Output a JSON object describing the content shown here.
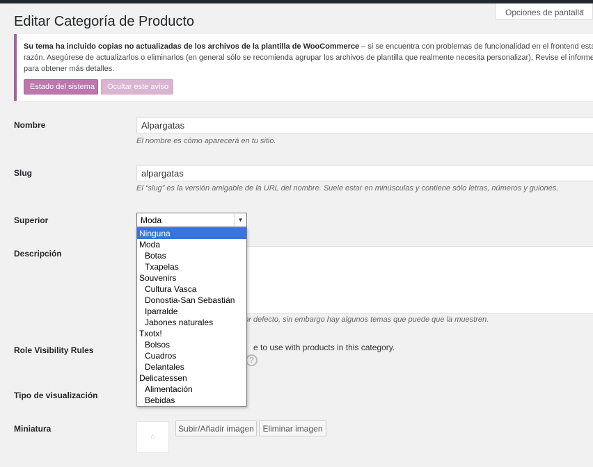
{
  "screen_options": {
    "label": "Opciones de pantalla",
    "arrow": "▼"
  },
  "page": {
    "title": "Editar Categoría de Producto"
  },
  "notice": {
    "bold": "Su tema ha incluido copias no actualizadas de los archivos de la plantilla de WooCommerce",
    "line1_rest": " – si se encuentra con problemas de funcionalidad en el frontend esta podr",
    "line2": "razón. Asegúrese de actualizarlos o eliminarlos (en general sólo se recomienda agrupar los archivos de plantilla que realmente necesita personalizar). Revise el informe d",
    "line3": "para obtener más detalles.",
    "status_button": "Estado del sistema",
    "hide_button": "Ocultar este aviso"
  },
  "form": {
    "name_label": "Nombre",
    "name_value": "Alpargatas",
    "name_desc": "El nombre es cómo aparecerá en tu sitio.",
    "slug_label": "Slug",
    "slug_value": "alpargatas",
    "slug_desc": "El “slug” es la versión amigable de la URL del nombre. Suele estar en minúsculas y contiene sólo letras, números y guiones.",
    "parent_label": "Superior",
    "parent_selected": "Moda",
    "description_label": "Descripción",
    "description_desc_partial": "por defecto, sin embargo hay algunos temas que puede que la muestren.",
    "role_label": "Role Visibility Rules",
    "role_text_partial": "e to use with products in this category.",
    "help_icon": "?",
    "display_type_label": "Tipo de visualización",
    "thumbnail_label": "Miniatura",
    "upload_button": "Subir/Añadir imagen",
    "remove_button": "Eliminar imagen"
  },
  "dropdown_options": [
    {
      "label": "Ninguna",
      "level": 0,
      "selected": true
    },
    {
      "label": "Moda",
      "level": 0
    },
    {
      "label": "Botas",
      "level": 1
    },
    {
      "label": "Txapelas",
      "level": 1
    },
    {
      "label": "Souvenirs",
      "level": 0
    },
    {
      "label": "Cultura Vasca",
      "level": 1
    },
    {
      "label": "Donostia-San Sebastián",
      "level": 1
    },
    {
      "label": "Iparralde",
      "level": 1
    },
    {
      "label": "Jabones naturales",
      "level": 1
    },
    {
      "label": "Txotx!",
      "level": 0
    },
    {
      "label": "Bolsos",
      "level": 1
    },
    {
      "label": "Cuadros",
      "level": 1
    },
    {
      "label": "Delantales",
      "level": 1
    },
    {
      "label": "Delicatessen",
      "level": 0
    },
    {
      "label": "Alimentación",
      "level": 1
    },
    {
      "label": "Bebidas",
      "level": 1
    }
  ]
}
